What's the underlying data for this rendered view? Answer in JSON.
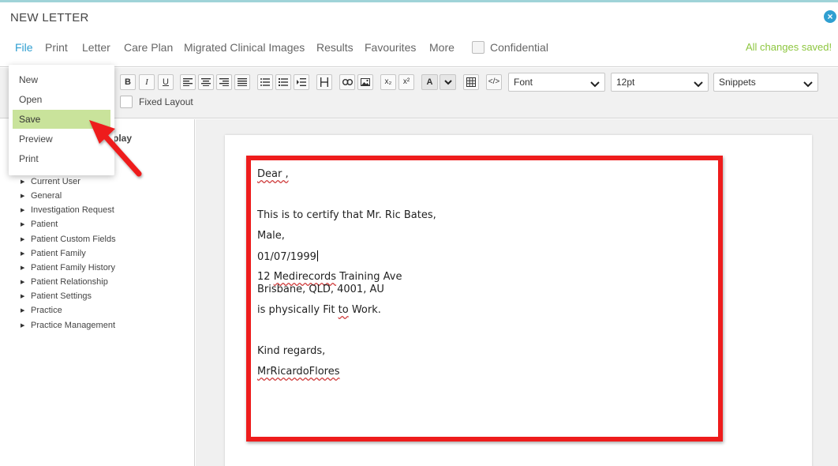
{
  "window": {
    "title": "NEW LETTER",
    "close_icon": "close-icon"
  },
  "menu": {
    "items": [
      "File",
      "Print",
      "Letter",
      "Care Plan",
      "Migrated Clinical Images",
      "Results",
      "Favourites",
      "More"
    ],
    "confidential_label": "Confidential",
    "status": "All changes saved!",
    "status_color": "#8dc63f",
    "accent_color": "#2f9fd1"
  },
  "toolbar": {
    "bold": "B",
    "italic": "I",
    "underline": "U",
    "subscript": "x₂",
    "superscript": "x²",
    "font_color": "A",
    "font_select": "Font",
    "size_select": "12pt",
    "snippets_select": "Snippets",
    "fixed_layout_label": "Fixed Layout"
  },
  "file_menu": {
    "items": [
      "New",
      "Open",
      "Save",
      "Preview",
      "Print"
    ],
    "selected": "Save"
  },
  "sidebar": {
    "heading_fragment": "play",
    "items": [
      "Current User",
      "General",
      "Investigation Request",
      "Patient",
      "Patient Custom Fields",
      "Patient Family",
      "Patient Family History",
      "Patient Relationship",
      "Patient Settings",
      "Practice",
      "Practice Management"
    ]
  },
  "letter": {
    "salutation": "Dear ,",
    "line1": "This is to certify that Mr. Ric Bates,",
    "line2": "Male,",
    "line3": "01/07/1999",
    "addr1_pre": "12 ",
    "addr1_word": "Medirecords",
    "addr1_post": " Training Ave",
    "addr2": "Brisbane, QLD, 4001, AU",
    "line4_pre": "is physically Fit ",
    "line4_word": "to",
    "line4_post": " Work.",
    "closing": "Kind regards,",
    "signature": "MrRicardoFlores"
  },
  "annotation_color": "#ee1c1c"
}
